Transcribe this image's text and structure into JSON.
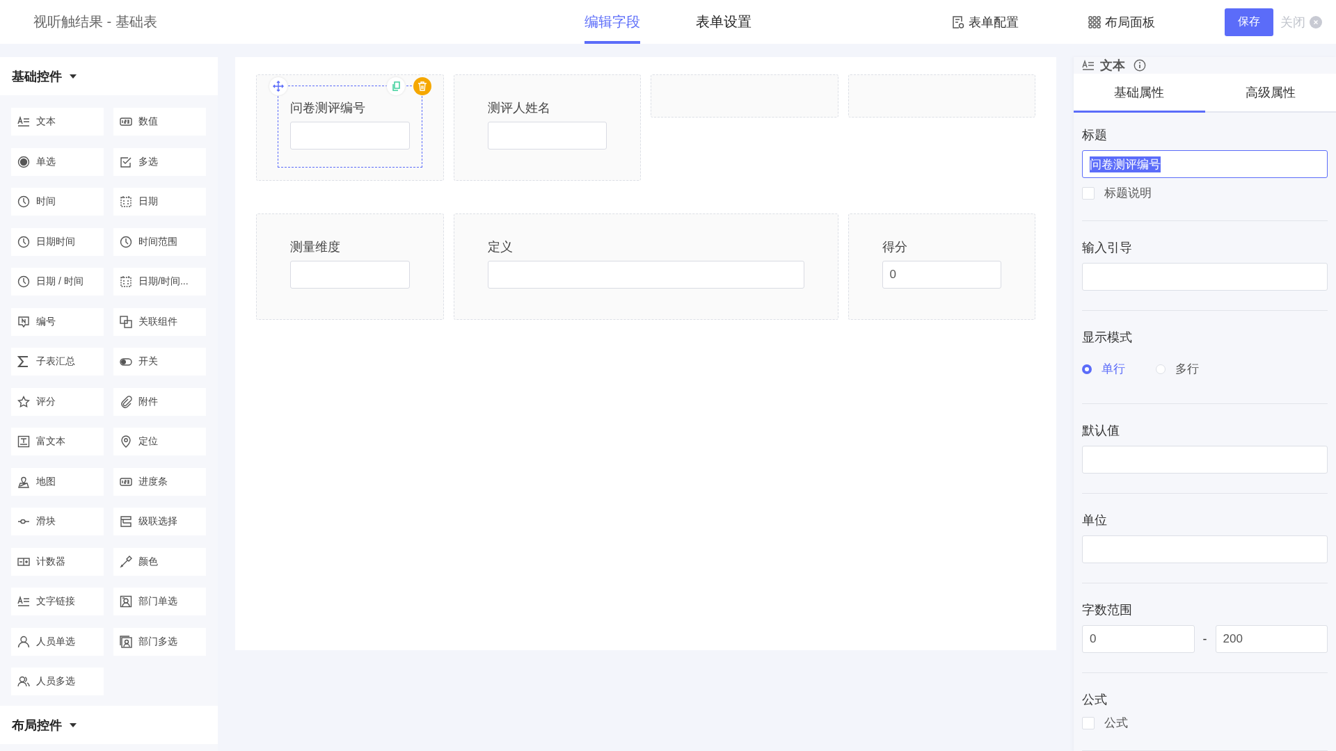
{
  "header": {
    "title": "视听触结果 - 基础表",
    "tabs": [
      {
        "label": "编辑字段",
        "selected": true
      },
      {
        "label": "表单设置",
        "selected": false
      }
    ],
    "actions": [
      {
        "label": "表单配置"
      },
      {
        "label": "布局面板"
      }
    ],
    "save": "保存",
    "close": "关闭"
  },
  "palette": {
    "title": "基础控件",
    "expanded": true,
    "items": [
      {
        "label": "文本"
      },
      {
        "label": "数值"
      },
      {
        "label": "单选"
      },
      {
        "label": "多选"
      },
      {
        "label": "时间"
      },
      {
        "label": "日期"
      },
      {
        "label": "日期时间"
      },
      {
        "label": "时间范围"
      },
      {
        "label": "日期 / 时间"
      },
      {
        "label": "日期/时间..."
      },
      {
        "label": "编号"
      },
      {
        "label": "关联组件"
      },
      {
        "label": "子表汇总"
      },
      {
        "label": "开关"
      },
      {
        "label": "评分"
      },
      {
        "label": "附件"
      },
      {
        "label": "富文本"
      },
      {
        "label": "定位"
      },
      {
        "label": "地图"
      },
      {
        "label": "进度条"
      },
      {
        "label": "滑块"
      },
      {
        "label": "级联选择"
      },
      {
        "label": "计数器"
      },
      {
        "label": "颜色"
      },
      {
        "label": "文字链接"
      },
      {
        "label": "部门单选"
      },
      {
        "label": "人员单选"
      },
      {
        "label": "部门多选"
      },
      {
        "label": "人员多选"
      }
    ],
    "layout_title": "布局控件",
    "layout_expanded": true
  },
  "canvas": {
    "rows": [
      [
        {
          "kind": "field",
          "label": "问卷测评编号",
          "selected": true
        },
        {
          "kind": "field",
          "label": "测评人姓名",
          "selected": false
        },
        {
          "kind": "empty"
        },
        {
          "kind": "empty"
        }
      ],
      [
        {
          "kind": "field",
          "label": "测量维度",
          "selected": false
        },
        {
          "kind": "wide-field",
          "label": "定义",
          "selected": false
        },
        {
          "kind": "field",
          "label": "得分",
          "value": "0",
          "selected": false
        }
      ]
    ]
  },
  "properties": {
    "title": "文本",
    "tabs": [
      {
        "label": "基础属性",
        "selected": true
      },
      {
        "label": "高级属性",
        "selected": false
      }
    ],
    "sections": [
      {
        "kind": "input",
        "label": "标题",
        "value": "问卷测评编号",
        "value_selected": true,
        "focused": true,
        "option": {
          "label": "标题说明",
          "checked": false
        }
      },
      {
        "kind": "input",
        "label": "输入引导",
        "focused": false
      },
      {
        "kind": "radio",
        "label": "显示模式",
        "options": [
          {
            "label": "单行",
            "selected": true
          },
          {
            "label": "多行",
            "selected": false
          }
        ]
      },
      {
        "kind": "input",
        "label": "默认值",
        "focused": false
      },
      {
        "kind": "input",
        "label": "单位",
        "focused": false
      },
      {
        "kind": "range",
        "label": "字数范围",
        "min": "0",
        "separator": "-",
        "max": "200"
      },
      {
        "kind": "checkbox",
        "label": "公式",
        "option": {
          "label": "公式",
          "checked": false
        }
      }
    ]
  }
}
